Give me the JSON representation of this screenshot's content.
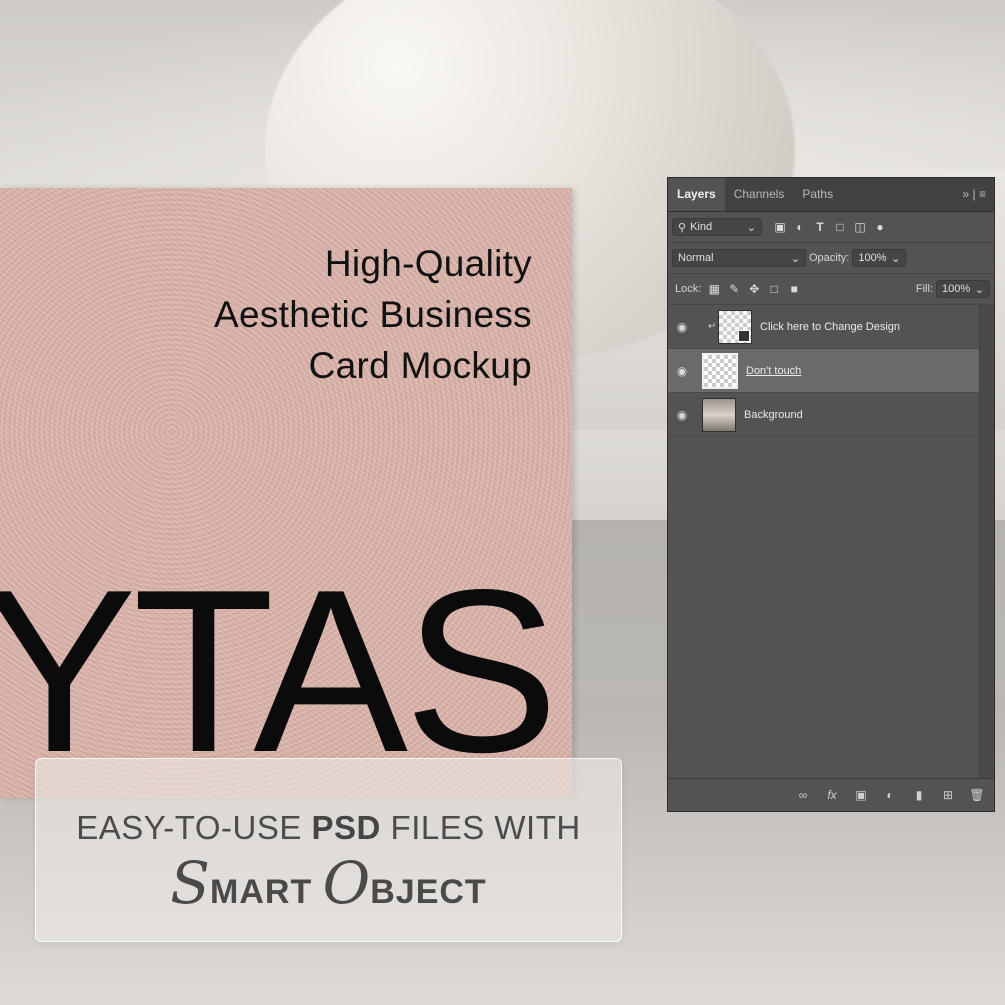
{
  "card": {
    "title_lines": [
      "High-Quality",
      "Aesthetic Business",
      "Card Mockup"
    ],
    "big_text": "YTAS"
  },
  "banner": {
    "line1_pre": "EASY-TO-USE ",
    "line1_bold": "PSD",
    "line1_post": " FILES WITH",
    "smart_cap": "S",
    "smart_rest": "MART ",
    "object_cap": "O",
    "object_rest": "BJECT"
  },
  "panel": {
    "tabs": [
      "Layers",
      "Channels",
      "Paths"
    ],
    "tab_menu_icons": "»  |  ≡",
    "filter_kind": "Kind",
    "blend_mode": "Normal",
    "opacity_label": "Opacity:",
    "opacity_value": "100%",
    "lock_label": "Lock:",
    "fill_label": "Fill:",
    "fill_value": "100%",
    "layers": [
      {
        "name": "Click here to Change Design",
        "visible": true,
        "clipped": true
      },
      {
        "name": "Don't touch",
        "visible": true,
        "selected": true
      },
      {
        "name": "Background",
        "visible": true
      }
    ],
    "filter_icons": [
      "image-filter-icon",
      "adjustment-filter-icon",
      "type-filter-icon",
      "shape-filter-icon",
      "smart-object-filter-icon"
    ],
    "lock_icons": [
      "lock-transparent-icon",
      "lock-image-icon",
      "lock-position-icon",
      "lock-artboard-icon",
      "lock-all-icon"
    ],
    "footer_icons": [
      "link-icon",
      "fx-icon",
      "mask-icon",
      "adjustment-icon",
      "folder-icon",
      "new-layer-icon",
      "trash-icon"
    ]
  }
}
